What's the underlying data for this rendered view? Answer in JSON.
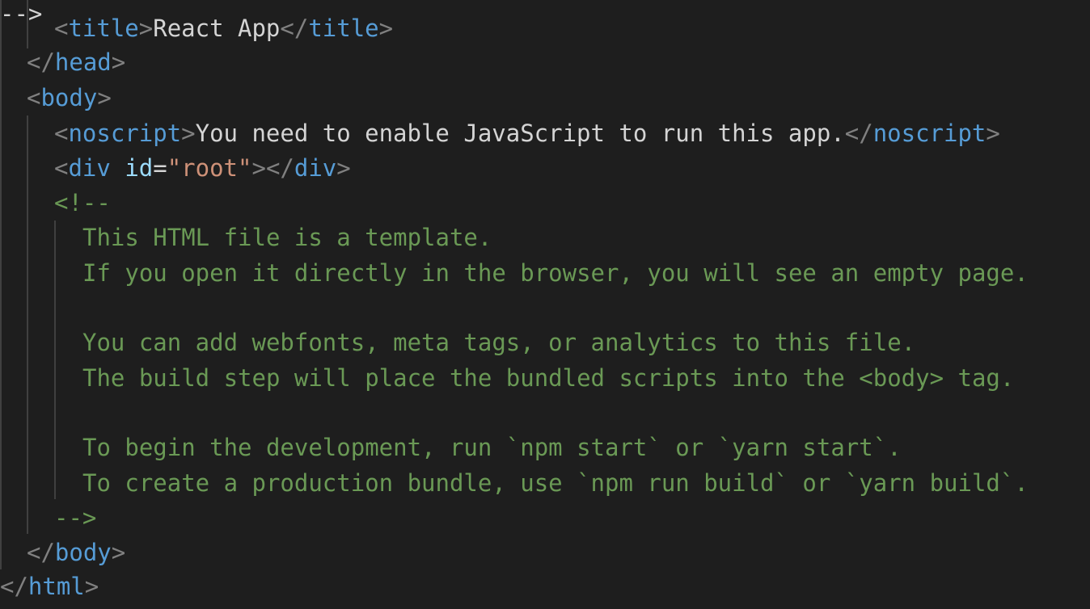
{
  "colors": {
    "background": "#1e1e1e",
    "punctuation": "#808080",
    "tag": "#569cd6",
    "attribute": "#9cdcfe",
    "string": "#ce9178",
    "text": "#d4d4d4",
    "comment": "#6a9955",
    "indent_guide": "#404040"
  },
  "code": {
    "title_tag": "title",
    "title_text": "React App",
    "head_tag": "head",
    "body_tag": "body",
    "noscript_tag": "noscript",
    "noscript_text": "You need to enable JavaScript to run this app.",
    "div_tag": "div",
    "div_attr": "id",
    "div_attr_value": "\"root\"",
    "comment_open": "<!--",
    "comment_lines": [
      "This HTML file is a template.",
      "If you open it directly in the browser, you will see an empty page.",
      "",
      "You can add webfonts, meta tags, or analytics to this file.",
      "The build step will place the bundled scripts into the <body> tag.",
      "",
      "To begin the development, run `npm start` or `yarn start`.",
      "To create a production bundle, use `npm run build` or `yarn build`."
    ],
    "comment_close": "-->",
    "html_tag": "html"
  }
}
